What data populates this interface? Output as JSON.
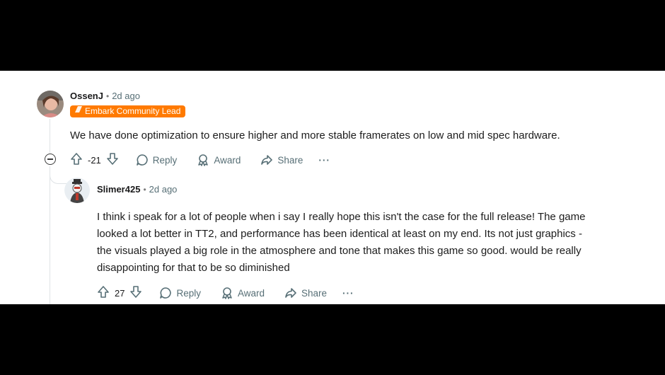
{
  "comments": [
    {
      "author": "OssenJ",
      "separator": "•",
      "time": "2d ago",
      "flair": "Embark Community Lead",
      "body": "We have done optimization to ensure higher and more stable framerates on low and mid spec hardware.",
      "score": "-21",
      "actions": {
        "reply": "Reply",
        "award": "Award",
        "share": "Share",
        "more": "···"
      }
    },
    {
      "author": "Slimer425",
      "separator": "•",
      "time": "2d ago",
      "body_lines": [
        "I think i speak for a lot of people when i say I really hope this isn't the case for the full release! The game",
        "looked a lot better in TT2, and performance has been identical at least on my end. Its not just graphics -",
        "the visuals played a big role in the atmosphere and tone that makes this game so good. would be really",
        "disappointing for that to be so diminished"
      ],
      "score": "27",
      "actions": {
        "reply": "Reply",
        "award": "Award",
        "share": "Share",
        "more": "···"
      }
    }
  ],
  "colors": {
    "flair_bg": "#ff7a00",
    "meta_gray": "#576f76",
    "thread_line": "#dfe3e6"
  },
  "icons": [
    "upvote-icon",
    "downvote-icon",
    "reply-icon",
    "award-icon",
    "share-icon",
    "more-icon",
    "collapse-icon"
  ]
}
